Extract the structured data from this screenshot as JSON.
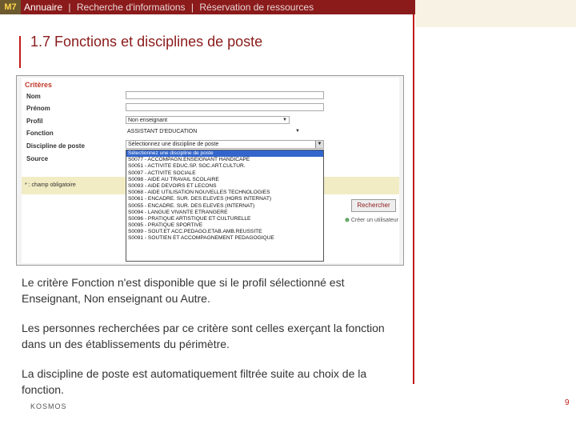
{
  "header": {
    "logo": "M7",
    "nav_active": "Annuaire",
    "nav_sep1": "|",
    "nav_item2": "Recherche d'informations",
    "nav_sep2": "|",
    "nav_item3": "Réservation de ressources"
  },
  "slide": {
    "title": "1.7 Fonctions et disciplines de poste"
  },
  "form": {
    "section_title": "Critères",
    "fields": [
      {
        "label": "Nom",
        "value": ""
      },
      {
        "label": "Prénom",
        "value": ""
      },
      {
        "label": "Profil",
        "value": "Non enseignant"
      },
      {
        "label": "Fonction",
        "value": "ASSISTANT D'EDUCATION"
      },
      {
        "label": "Discipline de poste",
        "value": "Sélectionnez une discipline de poste"
      },
      {
        "label": "Source",
        "value": ""
      }
    ],
    "required_note": "* : champ obligatoire",
    "search_button": "Rechercher",
    "create_user_link": "Créer un utilisateur",
    "discipline_options": [
      "Sélectionnez une discipline de poste",
      "S0077 - ACCOMPAGN.ENSEIGNANT HANDICAPE",
      "S0051 - ACTIVITE EDUC.SP. SOC.ART.CULTUR.",
      "S0097 - ACTIVITE SOCIALE",
      "S0098 - AIDE AU TRAVAIL SCOLAIRE",
      "S0093 - AIDE DEVOIRS ET LECONS",
      "S0068 - AIDE UTILISATION NOUVELLES TECHNOLOGIES",
      "S0061 - ENCADRE. SUR. DES ELEVES (HORS INTERNAT)",
      "S0055 - ENCADRE. SUR. DES ELEVES (INTERNAT)",
      "S0094 - LANGUE VIVANTE ETRANGERE",
      "S0096 - PRATIQUE ARTISTIQUE ET CULTURELLE",
      "S0095 - PRATIQUE SPORTIVE",
      "S0099 - SOUT.ET ACC.PEDAGO.ETAB.AMB.REUSSITE",
      "S0091 - SOUTIEN ET ACCOMPAGNEMENT PEDAGOGIQUE"
    ]
  },
  "body": {
    "para1": "Le critère Fonction n'est disponible que si le profil sélectionné est Enseignant, Non enseignant ou Autre.",
    "para2": "Les personnes recherchées par ce critère sont celles exerçant la fonction dans un des établissements du périmètre.",
    "para3": "La discipline de poste est automatiquement filtrée suite au choix de la fonction."
  },
  "footer": {
    "brand": "KOSMOS",
    "page": "9"
  },
  "colors": {
    "accent": "#8b1a1a",
    "line": "#c11b17",
    "cream": "#f7f2e3",
    "selection": "#3366cc"
  }
}
